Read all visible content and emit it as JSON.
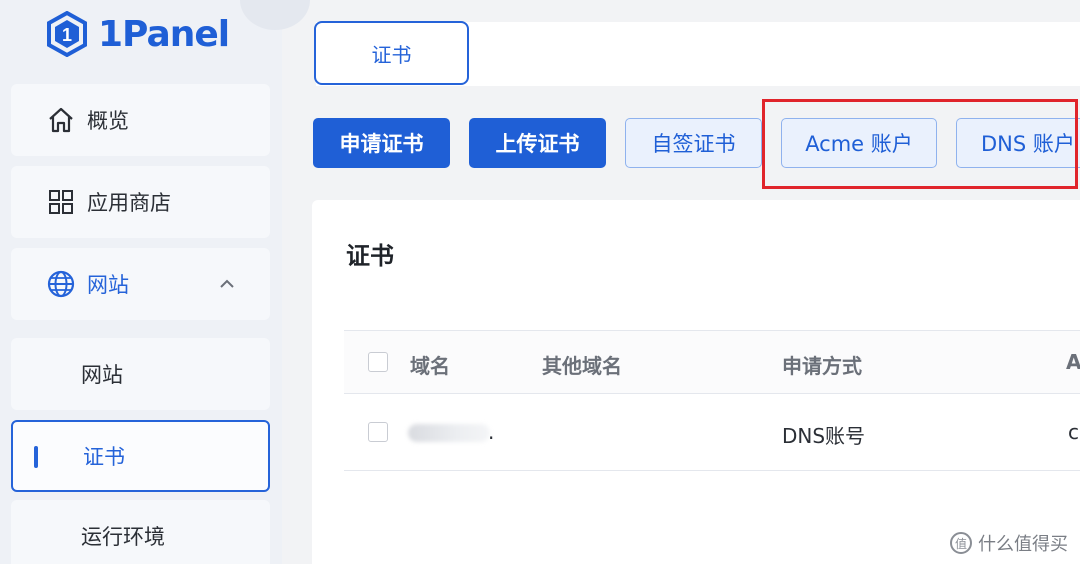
{
  "app": {
    "logo_text": "1Panel",
    "accent": "#2563d9",
    "highlight": "#e0242b"
  },
  "sidebar": {
    "overview": {
      "label": "概览",
      "icon": "home-icon"
    },
    "app_store": {
      "label": "应用商店",
      "icon": "grid-icon"
    },
    "sites": {
      "label": "网站",
      "icon": "globe-icon",
      "expanded": true
    },
    "sub": {
      "website": "网站",
      "certificate": "证书",
      "runtime": "运行环境"
    }
  },
  "tabs": {
    "active": "证书"
  },
  "toolbar": {
    "apply_cert": "申请证书",
    "upload_cert": "上传证书",
    "self_signed": "自签证书",
    "acme_account": "Acme 账户",
    "dns_account": "DNS 账户"
  },
  "card": {
    "title": "证书",
    "columns": [
      "域名",
      "其他域名",
      "申请方式",
      "A"
    ],
    "rows": [
      {
        "domain": "",
        "domain_suffix": ".",
        "other": "",
        "method": "DNS账号",
        "extra": "c"
      }
    ]
  },
  "watermark": {
    "text": "什么值得买",
    "icon_glyph": "值"
  }
}
